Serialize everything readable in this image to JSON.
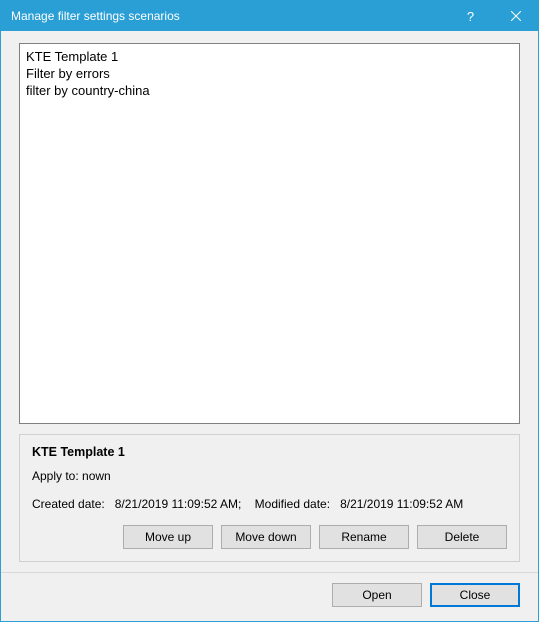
{
  "window": {
    "title": "Manage filter settings scenarios"
  },
  "list": {
    "items": [
      "KTE Template 1",
      "Filter by errors",
      "filter by country-china"
    ]
  },
  "details": {
    "title": "KTE Template 1",
    "apply_to_label": "Apply to:",
    "apply_to_value": "nown",
    "created_label": "Created date:",
    "created_value": "8/21/2019 11:09:52 AM;",
    "modified_label": "Modified date:",
    "modified_value": "8/21/2019 11:09:52 AM"
  },
  "buttons": {
    "move_up": "Move up",
    "move_down": "Move down",
    "rename": "Rename",
    "delete": "Delete",
    "open": "Open",
    "close": "Close"
  }
}
